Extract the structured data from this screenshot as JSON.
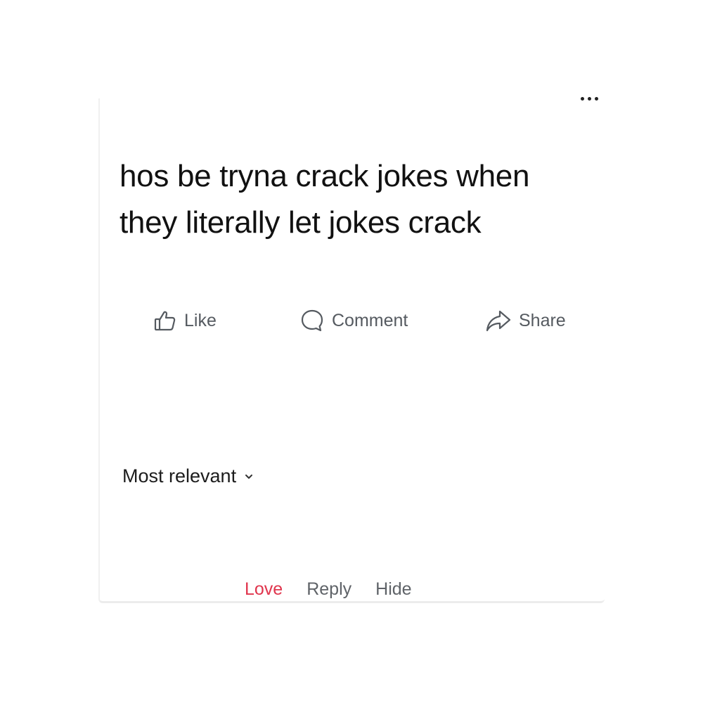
{
  "post": {
    "text": "hos be tryna crack jokes when they literally let jokes crack",
    "more_icon": "more-dots-icon"
  },
  "actions": {
    "like": {
      "label": "Like",
      "icon": "thumbs-up-icon"
    },
    "comment": {
      "label": "Comment",
      "icon": "comment-bubble-icon"
    },
    "share": {
      "label": "Share",
      "icon": "share-arrow-icon"
    }
  },
  "comments": {
    "sort_label": "Most relevant",
    "sort_icon": "chevron-down-icon",
    "reaction_actions": {
      "love": "Love",
      "reply": "Reply",
      "hide": "Hide"
    }
  },
  "colors": {
    "love": "#e0354d",
    "action_text": "#555a60",
    "post_text": "#111111"
  }
}
